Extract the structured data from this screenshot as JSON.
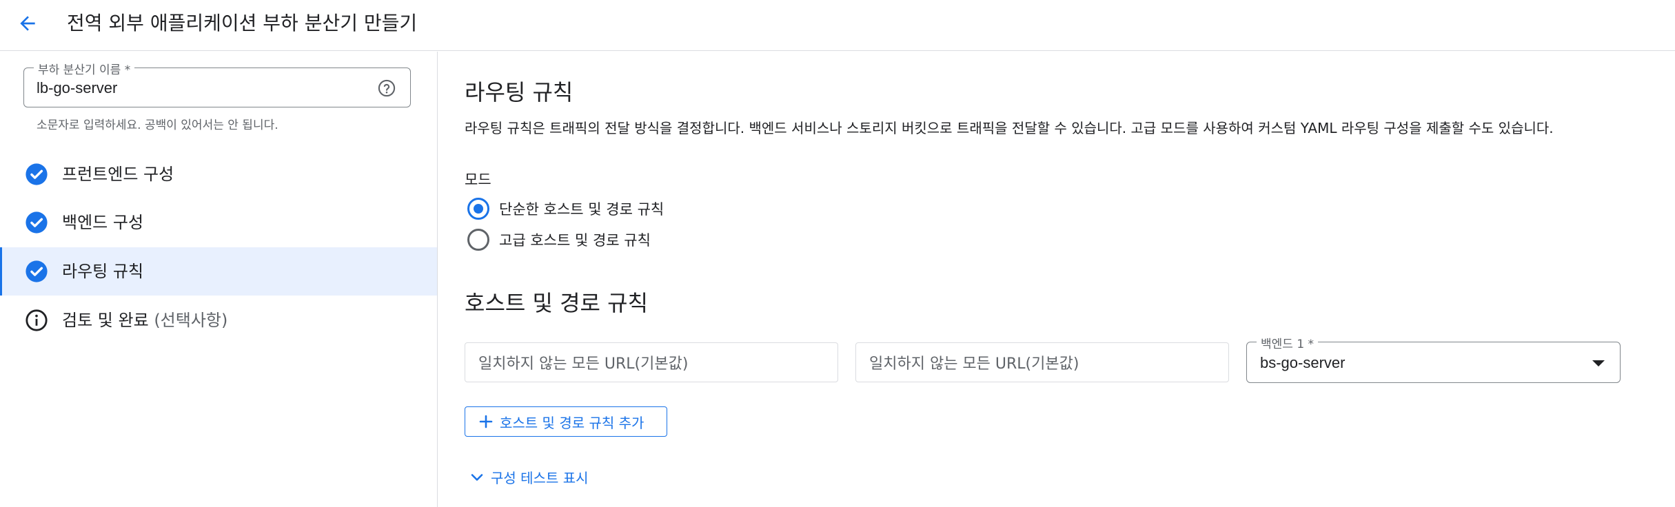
{
  "header": {
    "title": "전역 외부 애플리케이션 부하 분산기 만들기",
    "back_icon": "arrow-back-icon"
  },
  "sidebar": {
    "name_field": {
      "label": "부하 분산기 이름 *",
      "value": "lb-go-server",
      "hint": "소문자로 입력하세요. 공백이 있어서는 안 됩니다.",
      "help_icon": "help-circle-icon"
    },
    "steps": [
      {
        "label": "프런트엔드 구성",
        "status": "complete",
        "icon": "check-circle-icon",
        "active": false
      },
      {
        "label": "백엔드 구성",
        "status": "complete",
        "icon": "check-circle-icon",
        "active": false
      },
      {
        "label": "라우팅 규칙",
        "status": "complete",
        "icon": "check-circle-icon",
        "active": true
      },
      {
        "label": "검토 및 완료",
        "optional": "(선택사항)",
        "status": "info",
        "icon": "info-circle-icon",
        "active": false
      }
    ]
  },
  "main": {
    "title": "라우팅 규칙",
    "description": "라우팅 규칙은 트래픽의 전달 방식을 결정합니다. 백엔드 서비스나 스토리지 버킷으로 트래픽을 전달할 수 있습니다. 고급 모드를 사용하여 커스텀 YAML 라우팅 구성을 제출할 수도 있습니다.",
    "mode": {
      "label": "모드",
      "options": [
        {
          "label": "단순한 호스트 및 경로 규칙",
          "checked": true
        },
        {
          "label": "고급 호스트 및 경로 규칙",
          "checked": false
        }
      ]
    },
    "host_path": {
      "title": "호스트 및 경로 규칙",
      "host_placeholder": "일치하지 않는 모든 URL(기본값)",
      "path_placeholder": "일치하지 않는 모든 URL(기본값)",
      "backend_label": "백엔드 1 *",
      "backend_value": "bs-go-server",
      "add_button": "호스트 및 경로 규칙 추가",
      "test_toggle": "구성 테스트 표시"
    }
  },
  "colors": {
    "accent": "#1a73e8",
    "active_bg": "#e8f0fe",
    "text_primary": "#202124",
    "text_secondary": "#5f6368",
    "border": "#dadce0"
  }
}
